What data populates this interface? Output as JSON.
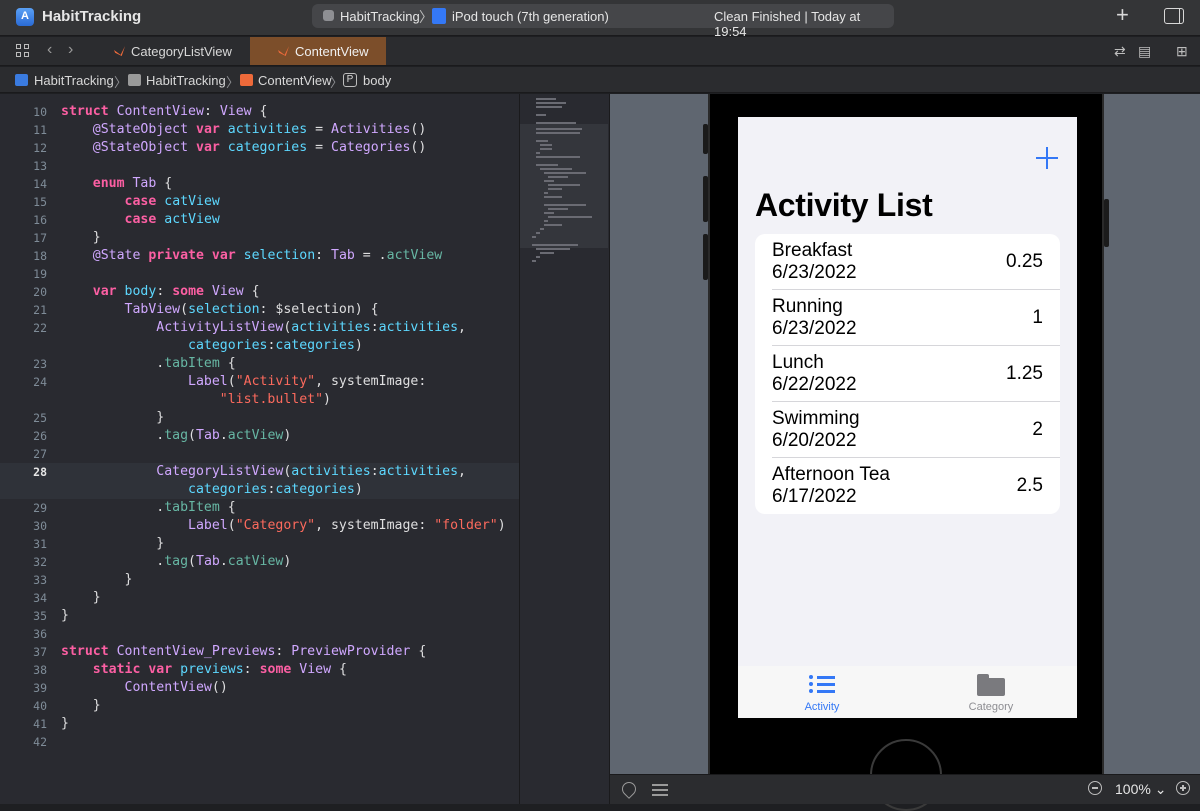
{
  "window": {
    "project_title": "HabitTracking",
    "scheme": "HabitTracking",
    "scheme_separator": "〉",
    "device": "iPod touch (7th generation)",
    "build_status": "Clean Finished | Today at 19:54"
  },
  "tabs": [
    {
      "label": "CategoryListView",
      "active": false,
      "icon": "swift-icon"
    },
    {
      "label": "ContentView",
      "active": true,
      "icon": "swift-icon"
    }
  ],
  "breadcrumb": {
    "items": [
      "HabitTracking",
      "HabitTracking",
      "ContentView",
      "body"
    ],
    "separator": "〉",
    "property_badge": "P"
  },
  "editor": {
    "current_line": 28,
    "lines": [
      {
        "n": "10",
        "code": "struct ContentView: View {"
      },
      {
        "n": "11",
        "code": "    @StateObject var activities = Activities()"
      },
      {
        "n": "12",
        "code": "    @StateObject var categories = Categories()"
      },
      {
        "n": "13",
        "code": ""
      },
      {
        "n": "14",
        "code": "    enum Tab {"
      },
      {
        "n": "15",
        "code": "        case catView"
      },
      {
        "n": "16",
        "code": "        case actView"
      },
      {
        "n": "17",
        "code": "    }"
      },
      {
        "n": "18",
        "code": "    @State private var selection: Tab = .actView"
      },
      {
        "n": "19",
        "code": ""
      },
      {
        "n": "20",
        "code": "    var body: some View {"
      },
      {
        "n": "21",
        "code": "        TabView(selection: $selection) {"
      },
      {
        "n": "22",
        "code": "            ActivityListView(activities:activities,"
      },
      {
        "n": "",
        "code": "                categories:categories)"
      },
      {
        "n": "23",
        "code": "            .tabItem {"
      },
      {
        "n": "24",
        "code": "                Label(\"Activity\", systemImage:"
      },
      {
        "n": "",
        "code": "                    \"list.bullet\")"
      },
      {
        "n": "25",
        "code": "            }"
      },
      {
        "n": "26",
        "code": "            .tag(Tab.actView)"
      },
      {
        "n": "27",
        "code": ""
      },
      {
        "n": "28",
        "code": "            CategoryListView(activities:activities,"
      },
      {
        "n": "",
        "code": "                categories:categories)"
      },
      {
        "n": "29",
        "code": "            .tabItem {"
      },
      {
        "n": "30",
        "code": "                Label(\"Category\", systemImage: \"folder\")"
      },
      {
        "n": "31",
        "code": "            }"
      },
      {
        "n": "32",
        "code": "            .tag(Tab.catView)"
      },
      {
        "n": "33",
        "code": "        }"
      },
      {
        "n": "34",
        "code": "    }"
      },
      {
        "n": "35",
        "code": "}"
      },
      {
        "n": "36",
        "code": ""
      },
      {
        "n": "37",
        "code": "struct ContentView_Previews: PreviewProvider {"
      },
      {
        "n": "38",
        "code": "    static var previews: some View {"
      },
      {
        "n": "39",
        "code": "        ContentView()"
      },
      {
        "n": "40",
        "code": "    }"
      },
      {
        "n": "41",
        "code": "}"
      },
      {
        "n": "42",
        "code": ""
      }
    ]
  },
  "preview": {
    "nav_title": "Activity List",
    "activities": [
      {
        "name": "Breakfast",
        "date": "6/23/2022",
        "value": "0.25"
      },
      {
        "name": "Running",
        "date": "6/23/2022",
        "value": "1"
      },
      {
        "name": "Lunch",
        "date": "6/22/2022",
        "value": "1.25"
      },
      {
        "name": "Swimming",
        "date": "6/20/2022",
        "value": "2"
      },
      {
        "name": "Afternoon Tea",
        "date": "6/17/2022",
        "value": "2.5"
      }
    ],
    "tab_items": [
      {
        "label": "Activity",
        "icon": "list-bullet-icon",
        "selected": true
      },
      {
        "label": "Category",
        "icon": "folder-icon",
        "selected": false
      }
    ],
    "accent_color": "#3478f6",
    "inactive_color": "#8e8e93"
  },
  "canvas_footer": {
    "zoom": "100% ⌄"
  }
}
